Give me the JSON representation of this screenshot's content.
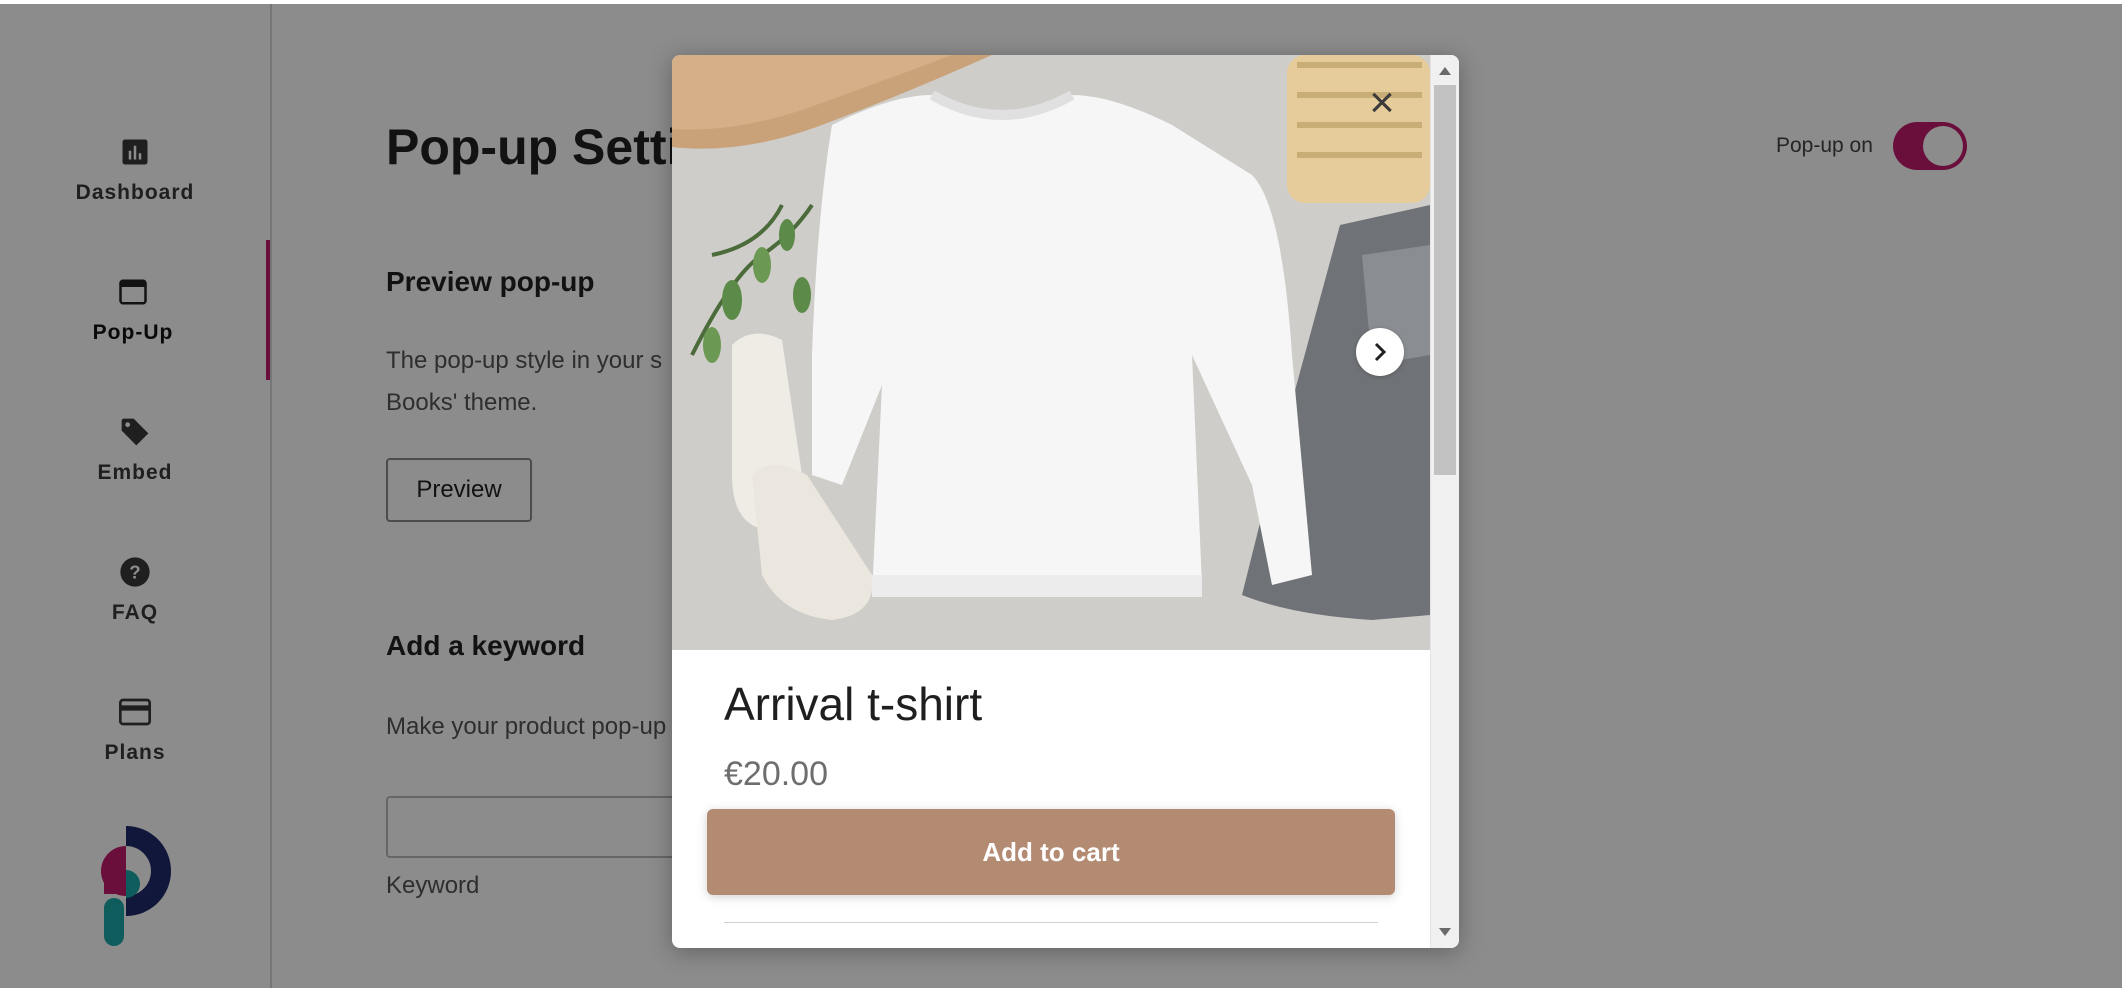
{
  "sidebar": {
    "items": [
      {
        "label": "Dashboard",
        "icon": "bar-chart-icon"
      },
      {
        "label": "Pop-Up",
        "icon": "window-icon",
        "active": true
      },
      {
        "label": "Embed",
        "icon": "tag-icon"
      },
      {
        "label": "FAQ",
        "icon": "question-circle-icon"
      },
      {
        "label": "Plans",
        "icon": "credit-card-icon"
      }
    ],
    "logo": "app-logo"
  },
  "main": {
    "title": "Pop-up Setti",
    "toggle": {
      "label": "Pop-up on",
      "on": true
    },
    "preview": {
      "title": "Preview pop-up",
      "line1": "The pop-up style in your s",
      "line2": "Books' theme.",
      "button": "Preview"
    },
    "keyword": {
      "title": "Add a keyword",
      "text": "Make your product pop-up",
      "value": "",
      "label": "Keyword"
    }
  },
  "modal": {
    "product_title": "Arrival t-shirt",
    "price": "€20.00",
    "add_to_cart": "Add to cart",
    "close_icon": "close-icon",
    "next_icon": "chevron-right-icon"
  },
  "colors": {
    "accent": "#c21a6e",
    "button": "#b38b73",
    "logo_navy": "#1f2a6b",
    "logo_teal": "#1aa8a8"
  }
}
